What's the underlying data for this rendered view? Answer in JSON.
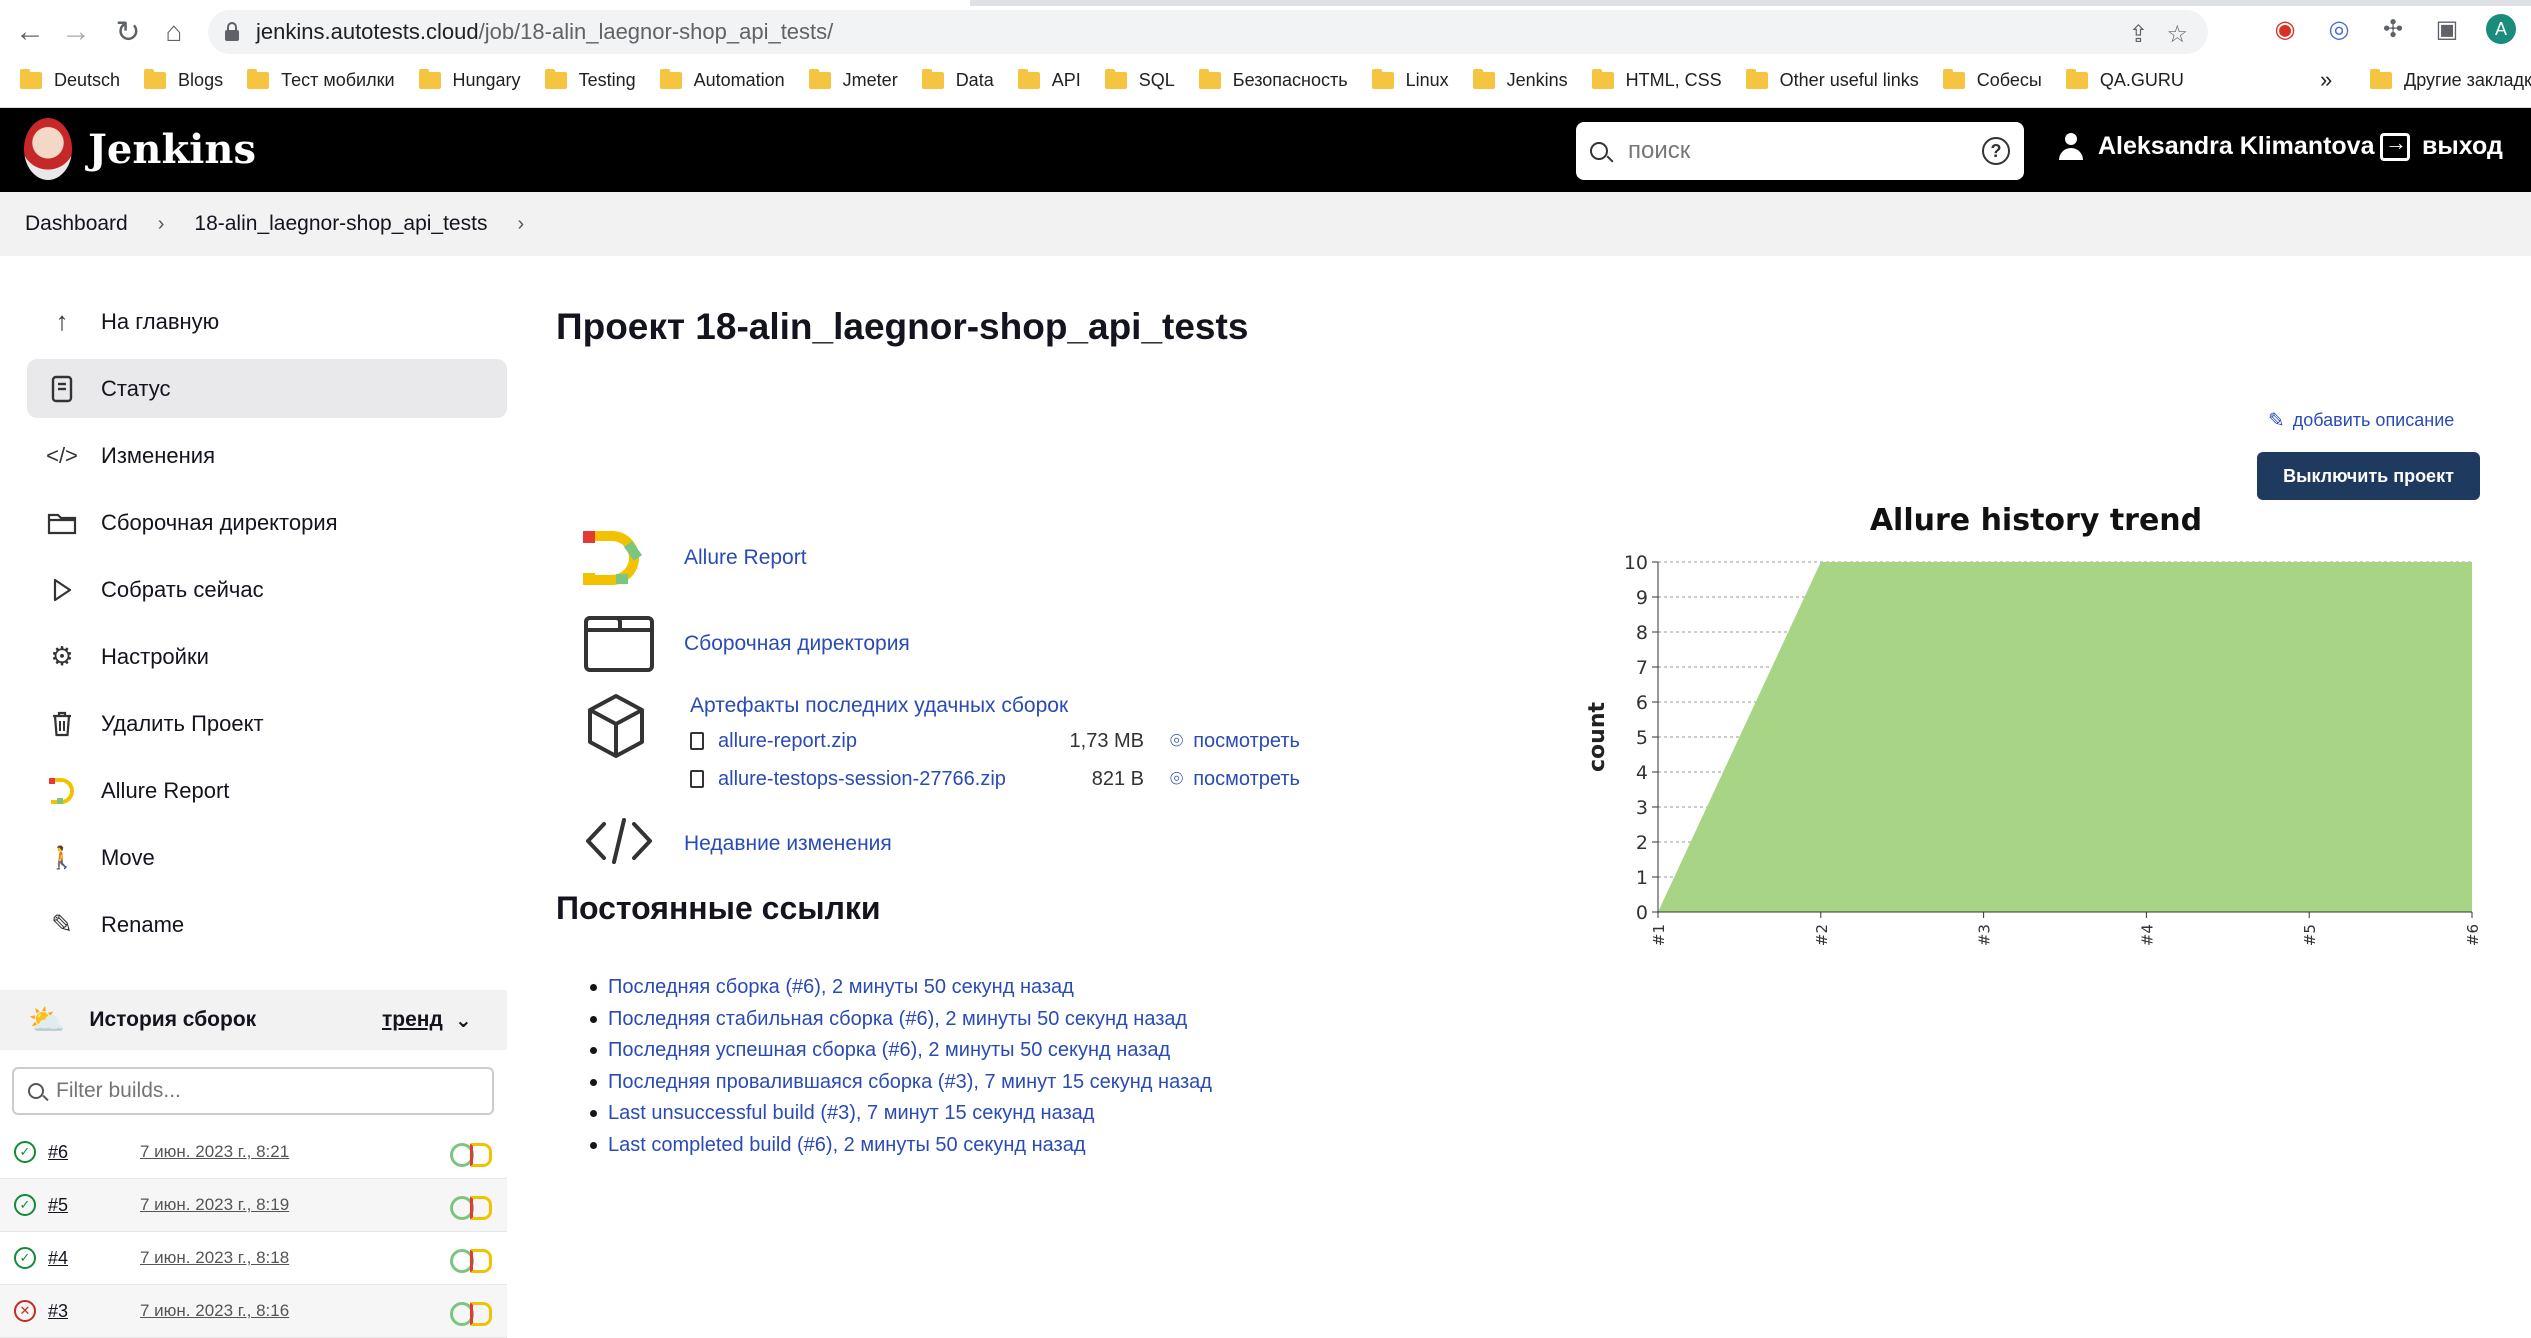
{
  "browser": {
    "url_host": "jenkins.autotests.cloud",
    "url_path": "/job/18-alin_laegnor-shop_api_tests/",
    "avatar_letter": "A",
    "bookmarks": [
      "Deutsch",
      "Blogs",
      "Тест мобилки",
      "Hungary",
      "Testing",
      "Automation",
      "Jmeter",
      "Data",
      "API",
      "SQL",
      "Безопасность",
      "Linux",
      "Jenkins",
      "HTML, CSS",
      "Other useful links",
      "Собесы",
      "QA.GURU"
    ],
    "bookmarks_more": "»",
    "bookmarks_other": "Другие закладки"
  },
  "header": {
    "app_name": "Jenkins",
    "search_placeholder": "поиск",
    "help": "?",
    "user_name": "Aleksandra Klimantova",
    "logout_label": "выход"
  },
  "breadcrumb": {
    "items": [
      "Dashboard",
      "18-alin_laegnor-shop_api_tests"
    ],
    "sep": "›"
  },
  "sidebar": {
    "items": [
      {
        "label": "На главную",
        "icon": "arrow-up-icon"
      },
      {
        "label": "Статус",
        "icon": "document-icon"
      },
      {
        "label": "Изменения",
        "icon": "code-icon"
      },
      {
        "label": "Сборочная директория",
        "icon": "folder-icon"
      },
      {
        "label": "Собрать сейчас",
        "icon": "play-icon"
      },
      {
        "label": "Настройки",
        "icon": "gear-icon"
      },
      {
        "label": "Удалить Проект",
        "icon": "trash-icon"
      },
      {
        "label": "Allure Report",
        "icon": "allure-icon"
      },
      {
        "label": "Move",
        "icon": "move-icon"
      },
      {
        "label": "Rename",
        "icon": "pencil-icon"
      }
    ],
    "history_title": "История сборок",
    "trend_label": "тренд",
    "filter_placeholder": "Filter builds...",
    "builds": [
      {
        "num": "#6",
        "date": "7 июн. 2023 г., 8:21",
        "status": "success"
      },
      {
        "num": "#5",
        "date": "7 июн. 2023 г., 8:19",
        "status": "success"
      },
      {
        "num": "#4",
        "date": "7 июн. 2023 г., 8:18",
        "status": "success"
      },
      {
        "num": "#3",
        "date": "7 июн. 2023 г., 8:16",
        "status": "failed"
      }
    ]
  },
  "main": {
    "title": "Проект 18-alin_laegnor-shop_api_tests",
    "add_description": "добавить описание",
    "disable_button": "Выключить проект",
    "allure_report": "Allure Report",
    "workspace": "Сборочная директория",
    "artifacts_title": "Артефакты последних удачных сборок",
    "artifacts": [
      {
        "name": "allure-report.zip",
        "size": "1,73 MB",
        "view": "посмотреть"
      },
      {
        "name": "allure-testops-session-27766.zip",
        "size": "821 B",
        "view": "посмотреть"
      }
    ],
    "recent_changes": "Недавние изменения",
    "permalinks_title": "Постоянные ссылки",
    "permalinks": [
      "Последняя сборка (#6), 2 минуты 50 секунд назад",
      "Последняя стабильная сборка (#6), 2 минуты 50 секунд назад",
      "Последняя успешная сборка (#6), 2 минуты 50 секунд назад",
      "Последняя провалившаяся сборка (#3), 7 минут 15 секунд назад",
      "Last unsuccessful build (#3), 7 минут 15 секунд назад",
      "Last completed build (#6), 2 минуты 50 секунд назад"
    ]
  },
  "chart_data": {
    "type": "area",
    "title": "Allure history trend",
    "xlabel": "",
    "ylabel": "count",
    "categories": [
      "#1",
      "#2",
      "#3",
      "#4",
      "#5",
      "#6"
    ],
    "values": [
      0,
      10,
      10,
      10,
      10,
      10
    ],
    "ylim": [
      0,
      10
    ],
    "yticks": [
      0,
      1,
      2,
      3,
      4,
      5,
      6,
      7,
      8,
      9,
      10
    ],
    "grid": true,
    "color": "#a8d485"
  }
}
